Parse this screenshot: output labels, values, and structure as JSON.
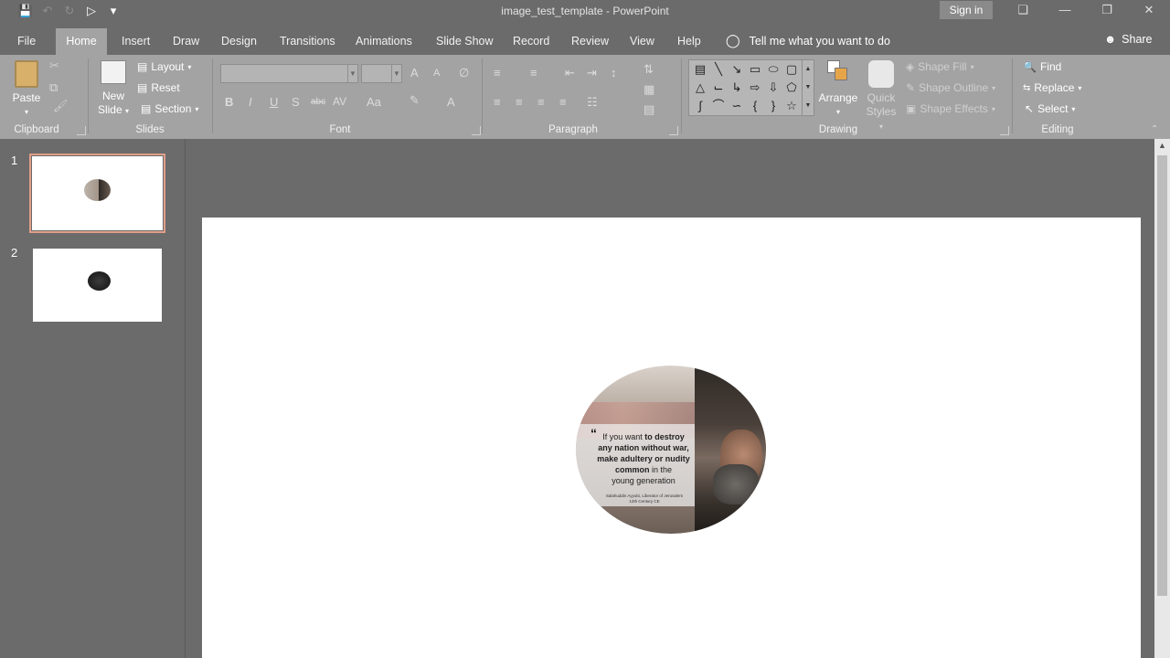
{
  "window": {
    "title": "image_test_template  -  PowerPoint",
    "sign_in": "Sign in"
  },
  "tabs": [
    "File",
    "Home",
    "Insert",
    "Draw",
    "Design",
    "Transitions",
    "Animations",
    "Slide Show",
    "Record",
    "Review",
    "View",
    "Help"
  ],
  "active_tab": "Home",
  "tell_me": "Tell me what you want to do",
  "share": "Share",
  "ribbon": {
    "clipboard": {
      "label": "Clipboard",
      "paste": "Paste"
    },
    "slides": {
      "label": "Slides",
      "new_slide_1": "New",
      "new_slide_2": "Slide",
      "layout": "Layout",
      "reset": "Reset",
      "section": "Section"
    },
    "font": {
      "label": "Font",
      "bold": "B",
      "italic": "I",
      "underline": "U",
      "shadow": "S",
      "strike": "abc",
      "spacing": "AV",
      "case": "Aa",
      "grow": "A",
      "shrink": "A",
      "color": "A"
    },
    "paragraph": {
      "label": "Paragraph"
    },
    "drawing": {
      "label": "Drawing",
      "arrange": "Arrange",
      "quick_styles_1": "Quick",
      "quick_styles_2": "Styles",
      "shape_fill": "Shape Fill",
      "shape_outline": "Shape Outline",
      "shape_effects": "Shape Effects"
    },
    "editing": {
      "label": "Editing",
      "find": "Find",
      "replace": "Replace",
      "select": "Select"
    }
  },
  "slides": [
    {
      "number": "1",
      "selected": true
    },
    {
      "number": "2",
      "selected": false
    }
  ],
  "slide_image": {
    "quote_mark": "“",
    "line1_light": "If you want ",
    "line1_bold": "to destroy",
    "line2": "any nation without war,",
    "line3": "make adultery or nudity",
    "line4_bold": "common",
    "line4_light": " in the",
    "line5": "young generation",
    "attribution_1": "Salahuddin Ayyubi, Liberator of Jerusalem",
    "attribution_2": "12th Century CE"
  }
}
